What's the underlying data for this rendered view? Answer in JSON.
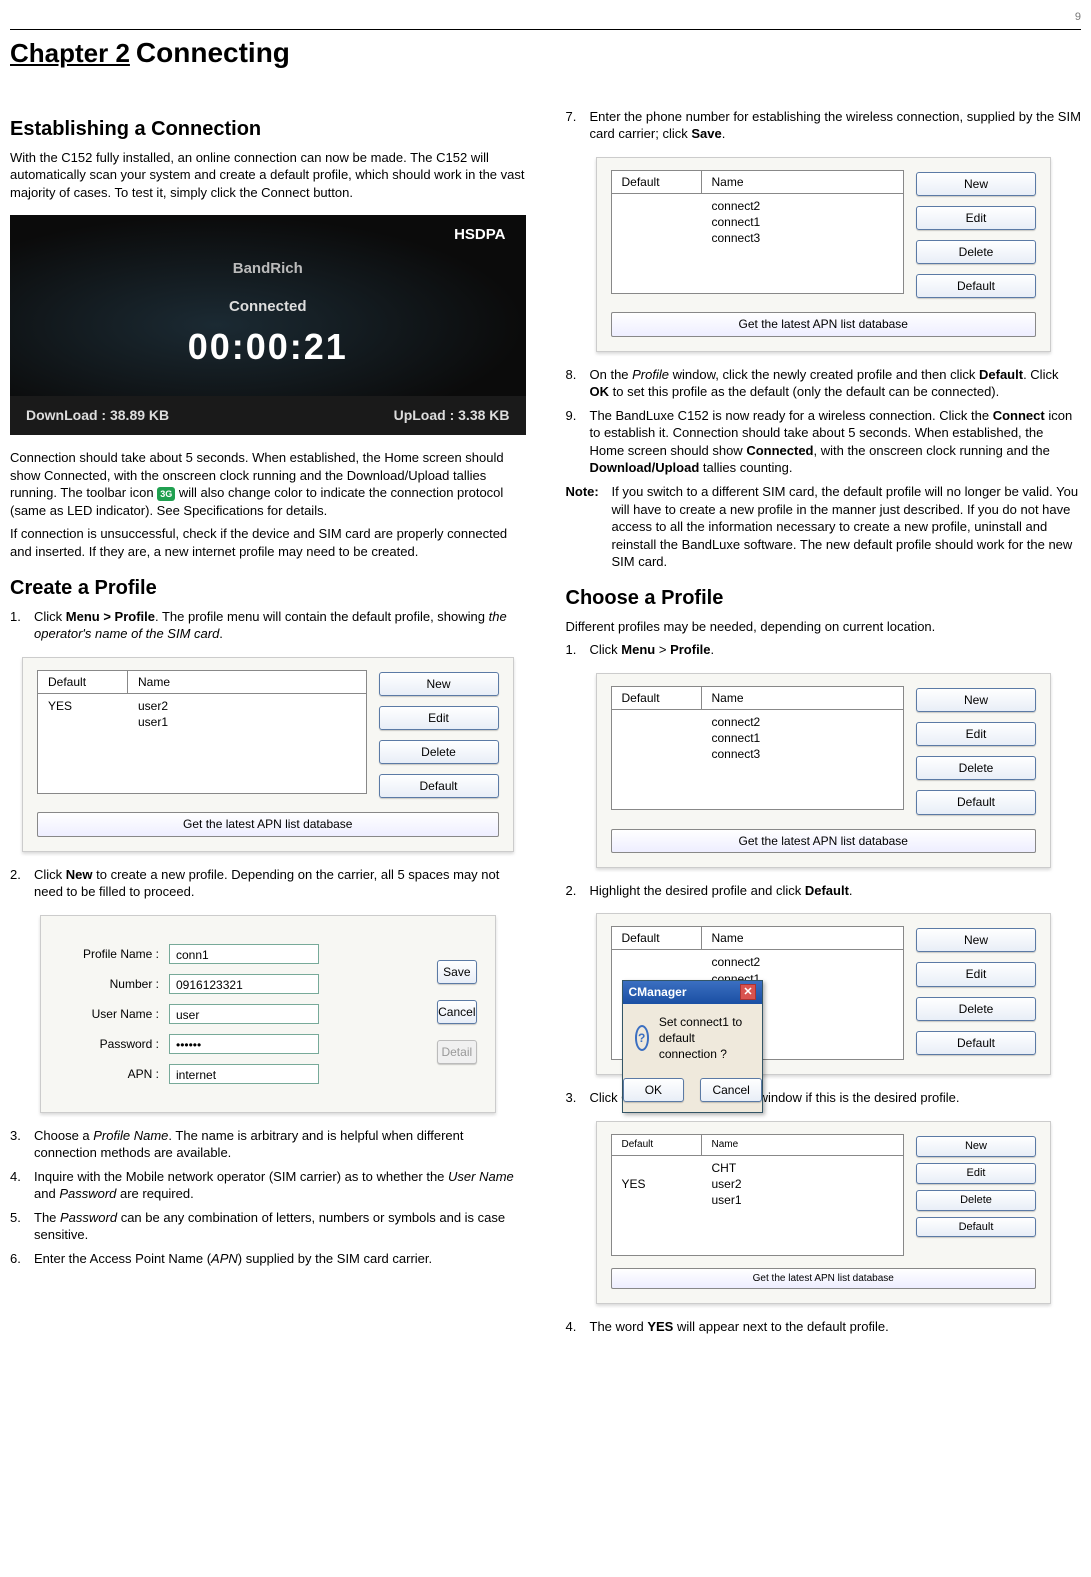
{
  "page_number": "9",
  "chapter_label": "Chapter 2",
  "chapter_title": "Connecting",
  "h_establish": "Establishing a Connection",
  "p_establish": "With the C152 fully installed, an online connection can now be made. The C152 will automatically scan your system and create a default profile, which should work in the vast majority of cases. To test it, simply click the Connect button.",
  "conn": {
    "hsdpa": "HSDPA",
    "brand": "BandRich",
    "status": "Connected",
    "timer": "00:00:21",
    "download": "DownLoad : 38.89 KB",
    "upload": "UpLoad : 3.38 KB"
  },
  "p_conn1a": "Connection should take about 5 seconds. When established, the Home screen should show Connected, with the onscreen clock running and the Download/Upload tallies running. The toolbar icon ",
  "p_conn1b": " will also change color to indicate the connection protocol (same as LED indicator). See Specifications for details.",
  "inline_icon": "3G",
  "p_conn2": "If connection is unsuccessful, check if the device and SIM card are properly connected and inserted. If they are, a new internet profile may need to be created.",
  "h_create": "Create a Profile",
  "create_steps": {
    "s1a": "Click ",
    "s1b": "Menu > Profile",
    "s1c": ". The profile menu will contain the default profile, showing ",
    "s1d": "the operator's name of the SIM card",
    "s1e": ".",
    "s2a": "Click ",
    "s2b": "New",
    "s2c": " to create a new profile. Depending on the carrier, all 5 spaces may not need to be filled to proceed.",
    "s3a": "Choose a ",
    "s3b": "Profile Name",
    "s3c": ". The name is arbitrary and is helpful when different connection methods are available.",
    "s4a": "Inquire with the Mobile network operator (SIM carrier) as to whether the ",
    "s4b": "User Name",
    "s4c": " and ",
    "s4d": "Password",
    "s4e": " are required.",
    "s5a": "The ",
    "s5b": "Password",
    "s5c": " can be any combination of letters, numbers or symbols and is case sensitive.",
    "s6a": "Enter the Access Point Name (",
    "s6b": "APN",
    "s6c": ") supplied by the SIM card carrier.",
    "s7a": "Enter the phone number for establishing the wireless connection, supplied by the SIM card carrier; click ",
    "s7b": "Save",
    "s7c": ".",
    "s8a": "On the ",
    "s8b": "Profile",
    "s8c": " window, click the newly created profile and then click ",
    "s8d": "Default",
    "s8e": ". Click ",
    "s8f": "OK",
    "s8g": " to set this profile as the default (only the default can be connected).",
    "s9a": "The BandLuxe C152 is now ready for a wireless connection. Click the ",
    "s9b": "Connect",
    "s9c": " icon to establish it. Connection should take about 5 seconds. When established, the Home screen should show ",
    "s9d": "Connected",
    "s9e": ", with the onscreen clock running and the ",
    "s9f": "Download/Upload",
    "s9g": " tallies counting."
  },
  "note_lbl": "Note:",
  "note_txt": "If you switch to a different SIM card, the default profile will no longer be valid. You will have to create a new profile in the manner just described. If you do not have access to all the information necessary to create a new profile, uninstall and reinstall the BandLuxe software. The new default profile should work for the new SIM card.",
  "h_choose": "Choose a Profile",
  "p_choose": "Different profiles may be needed, depending on current location.",
  "choose_steps": {
    "s1a": "Click ",
    "s1b": "Menu",
    "s1c": " > ",
    "s1d": "Profile",
    "s1e": ".",
    "s2a": "Highlight the desired profile and click ",
    "s2b": "Default",
    "s2c": ".",
    "s3a": "Click ",
    "s3b": "OK",
    "s3c": " on the confirmation window if this is the desired profile.",
    "s4a": "The word ",
    "s4b": "YES",
    "s4c": " will appear next to the default profile."
  },
  "plist_labels": {
    "default": "Default",
    "name": "Name",
    "new": "New",
    "edit": "Edit",
    "delete": "Delete",
    "defaultbtn": "Default",
    "apn": "Get the latest APN list database"
  },
  "fig1": {
    "default_val": "YES",
    "rows": [
      "user2",
      "user1"
    ]
  },
  "fig2": {
    "lbl_profile": "Profile Name :",
    "lbl_number": "Number :",
    "lbl_user": "User Name :",
    "lbl_pass": "Password :",
    "lbl_apn": "APN :",
    "val_profile": "conn1",
    "val_number": "0916123321",
    "val_user": "user",
    "val_pass": "••••••",
    "val_apn": "internet",
    "btn_save": "Save",
    "btn_cancel": "Cancel",
    "btn_detail": "Detail"
  },
  "fig3": {
    "default_val": "",
    "rows": [
      "connect2",
      "connect1",
      "connect3"
    ]
  },
  "fig_confirm": {
    "title": "CManager",
    "msg": "Set connect1 to default connection ?",
    "ok": "OK",
    "cancel": "Cancel",
    "rows_above": [
      "connect2",
      "connect1"
    ]
  },
  "fig_last": {
    "default_val": "YES",
    "rows": [
      "CHT",
      "user2",
      "user1"
    ]
  }
}
